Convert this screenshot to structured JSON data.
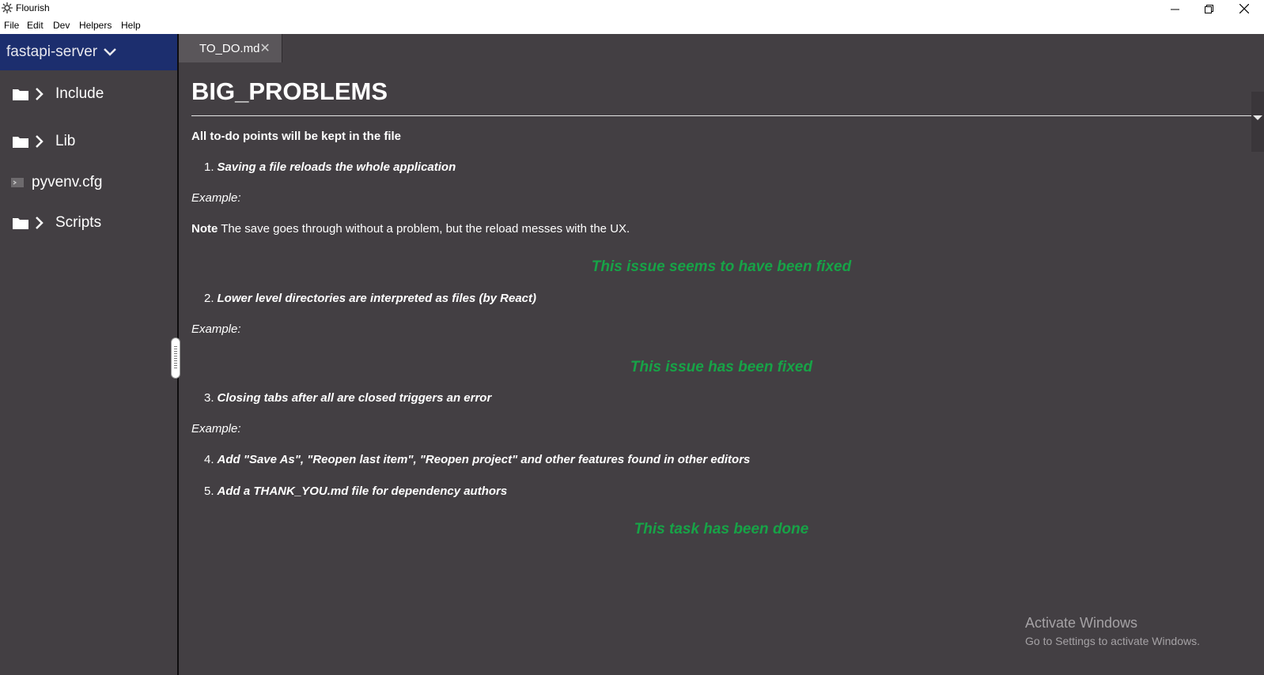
{
  "window": {
    "title": "Flourish"
  },
  "menu": [
    "File",
    "Edit",
    "Dev",
    "Helpers",
    "Help"
  ],
  "sidebar": {
    "project": "fastapi-server",
    "items": [
      {
        "label": "Include",
        "type": "folder"
      },
      {
        "label": "Lib",
        "type": "folder"
      },
      {
        "label": "pyvenv.cfg",
        "type": "file"
      },
      {
        "label": "Scripts",
        "type": "folder"
      }
    ]
  },
  "tabs": [
    {
      "label": "TO_DO.md",
      "close": "✕"
    }
  ],
  "doc": {
    "heading": "BIG_PROBLEMS",
    "intro": "All to-do points will be kept in the file",
    "items": [
      {
        "num": "1.",
        "text": "Saving a file reloads the whole application"
      },
      {
        "num": "2.",
        "text": "Lower level directories are interpreted as files (by React)"
      },
      {
        "num": "3.",
        "text": "Closing tabs after all are closed triggers an error"
      },
      {
        "num": "4.",
        "text": "Add \"Save As\", \"Reopen last item\", \"Reopen project\" and other features found in other editors"
      },
      {
        "num": "5.",
        "text": "Add a THANK_YOU.md file for dependency authors"
      }
    ],
    "example_label": "Example:",
    "note_label": "Note",
    "note_text": "The save goes through without a problem, but the reload messes with the UX.",
    "status": [
      "This issue seems to have been fixed",
      "This issue has been fixed",
      "This task has been done"
    ]
  },
  "watermark": {
    "line1": "Activate Windows",
    "line2": "Go to Settings to activate Windows."
  },
  "colors": {
    "accent_green": "#17a347",
    "project_header": "#1c2e6e",
    "background": "#433f43"
  }
}
